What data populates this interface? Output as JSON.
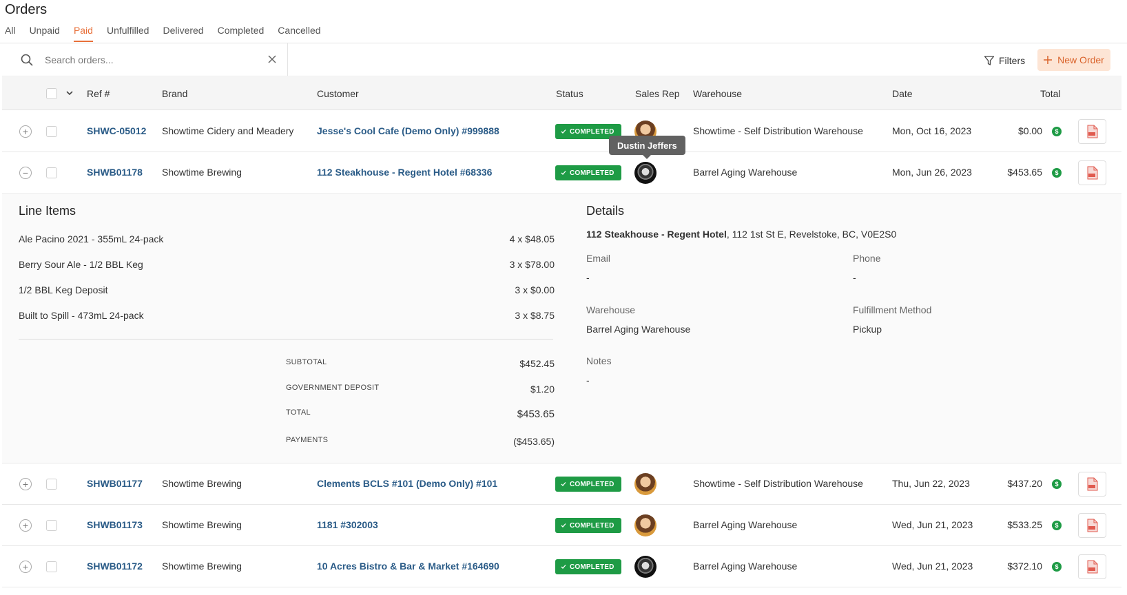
{
  "page": {
    "title": "Orders"
  },
  "tabs": [
    {
      "label": "All"
    },
    {
      "label": "Unpaid"
    },
    {
      "label": "Paid"
    },
    {
      "label": "Unfulfilled"
    },
    {
      "label": "Delivered"
    },
    {
      "label": "Completed"
    },
    {
      "label": "Cancelled"
    }
  ],
  "active_tab": "Paid",
  "search": {
    "placeholder": "Search orders...",
    "value": ""
  },
  "toolbar": {
    "filters_label": "Filters",
    "new_order_label": "New Order"
  },
  "table": {
    "headers": {
      "ref": "Ref #",
      "brand": "Brand",
      "customer": "Customer",
      "status": "Status",
      "sales_rep": "Sales Rep",
      "warehouse": "Warehouse",
      "date": "Date",
      "total": "Total"
    },
    "rows": [
      {
        "ref": "SHWC-05012",
        "brand": "Showtime Cidery and Meadery",
        "customer": "Jesse's Cool Cafe (Demo Only) #999888",
        "status": "COMPLETED",
        "warehouse": "Showtime - Self Distribution Warehouse",
        "date": "Mon, Oct 16, 2023",
        "total": "$0.00",
        "expanded": false
      },
      {
        "ref": "SHWB01178",
        "brand": "Showtime Brewing",
        "customer": "112 Steakhouse - Regent Hotel #68336",
        "status": "COMPLETED",
        "warehouse": "Barrel Aging Warehouse",
        "date": "Mon, Jun 26, 2023",
        "total": "$453.65",
        "expanded": true
      },
      {
        "ref": "SHWB01177",
        "brand": "Showtime Brewing",
        "customer": "Clements BCLS #101 (Demo Only) #101",
        "status": "COMPLETED",
        "warehouse": "Showtime - Self Distribution Warehouse",
        "date": "Thu, Jun 22, 2023",
        "total": "$437.20",
        "expanded": false
      },
      {
        "ref": "SHWB01173",
        "brand": "Showtime Brewing",
        "customer": "1181 #302003",
        "status": "COMPLETED",
        "warehouse": "Barrel Aging Warehouse",
        "date": "Wed, Jun 21, 2023",
        "total": "$533.25",
        "expanded": false
      },
      {
        "ref": "SHWB01172",
        "brand": "Showtime Brewing",
        "customer": "10 Acres Bistro & Bar & Market #164690",
        "status": "COMPLETED",
        "warehouse": "Barrel Aging Warehouse",
        "date": "Wed, Jun 21, 2023",
        "total": "$372.10",
        "expanded": false
      }
    ]
  },
  "tooltip": {
    "text": "Dustin Jeffers"
  },
  "detail": {
    "line_items_title": "Line Items",
    "line_items": [
      {
        "name": "Ale Pacino 2021 - 355mL 24-pack",
        "qty": "4 x $48.05"
      },
      {
        "name": "Berry Sour Ale - 1/2 BBL Keg",
        "qty": "3 x $78.00"
      },
      {
        "name": "1/2 BBL Keg Deposit",
        "qty": "3 x $0.00"
      },
      {
        "name": "Built to Spill - 473mL 24-pack",
        "qty": "3 x $8.75"
      }
    ],
    "summary": {
      "subtotal_label": "SUBTOTAL",
      "subtotal": "$452.45",
      "deposit_label": "GOVERNMENT DEPOSIT",
      "deposit": "$1.20",
      "total_label": "TOTAL",
      "total": "$453.65",
      "payments_label": "PAYMENTS",
      "payments": "($453.65)"
    },
    "details_title": "Details",
    "customer_name": "112 Steakhouse - Regent Hotel",
    "customer_address": ", 112 1st St E, Revelstoke, BC, V0E2S0",
    "email_label": "Email",
    "email": "-",
    "phone_label": "Phone",
    "phone": "-",
    "warehouse_label": "Warehouse",
    "warehouse": "Barrel Aging Warehouse",
    "fulfillment_label": "Fulfillment Method",
    "fulfillment": "Pickup",
    "notes_label": "Notes",
    "notes": "-"
  },
  "colors": {
    "accent": "#e8703a",
    "status_green": "#1e9b45",
    "link": "#2a5b87",
    "pdf_red": "#e05a4f"
  },
  "icons": {
    "search": "search-icon",
    "clear": "close-icon",
    "filter": "filter-icon",
    "add": "plus-icon",
    "pdf": "pdf-file-icon",
    "paid": "dollar-icon"
  }
}
